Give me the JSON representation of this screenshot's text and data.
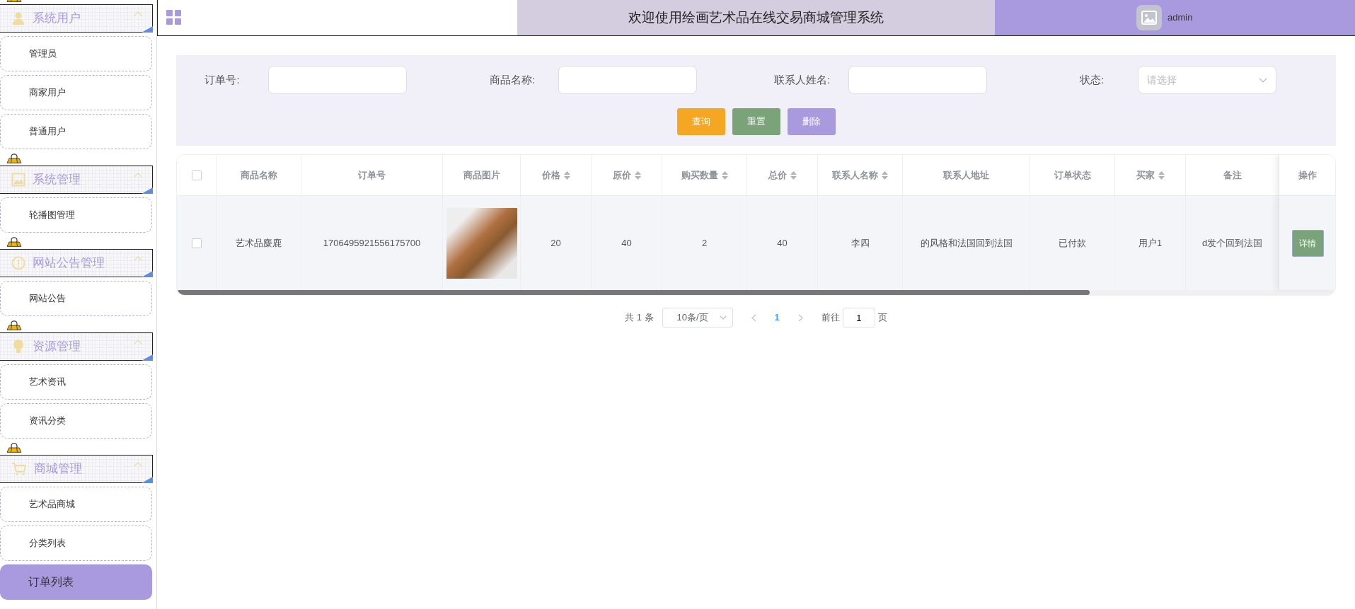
{
  "sidebar": {
    "groups": [
      {
        "title": "系统用户",
        "expanded": true,
        "items": [
          {
            "label": "管理员",
            "selected": false
          },
          {
            "label": "商家用户",
            "selected": false
          },
          {
            "label": "普通用户",
            "selected": false
          }
        ]
      },
      {
        "title": "系统管理",
        "expanded": true,
        "items": [
          {
            "label": "轮播图管理",
            "selected": false
          }
        ]
      },
      {
        "title": "网站公告管理",
        "expanded": true,
        "items": [
          {
            "label": "网站公告",
            "selected": false
          }
        ]
      },
      {
        "title": "资源管理",
        "expanded": true,
        "items": [
          {
            "label": "艺术资讯",
            "selected": false
          },
          {
            "label": "资讯分类",
            "selected": false
          }
        ]
      },
      {
        "title": "商城管理",
        "expanded": true,
        "items": [
          {
            "label": "艺术品商城",
            "selected": false
          },
          {
            "label": "分类列表",
            "selected": false
          },
          {
            "label": "订单列表",
            "selected": true
          }
        ]
      }
    ]
  },
  "header": {
    "title": "欢迎使用绘画艺术品在线交易商城管理系统",
    "user": "admin"
  },
  "search": {
    "fields": [
      {
        "label": "订单号:",
        "kind": "text"
      },
      {
        "label": "商品名称:",
        "kind": "text"
      },
      {
        "label": "联系人姓名:",
        "kind": "text"
      },
      {
        "label": "状态:",
        "kind": "select",
        "placeholder": "请选择"
      }
    ],
    "buttons": [
      {
        "label": "查询",
        "color": "#f5a623"
      },
      {
        "label": "重置",
        "color": "#7aa37a"
      },
      {
        "label": "删除",
        "color": "#a99adf"
      }
    ]
  },
  "table": {
    "all_checked": false,
    "columns": [
      {
        "title": "商品名称",
        "sortable": false
      },
      {
        "title": "订单号",
        "sortable": false
      },
      {
        "title": "商品图片",
        "sortable": false
      },
      {
        "title": "价格",
        "sortable": true
      },
      {
        "title": "原价",
        "sortable": true
      },
      {
        "title": "购买数量",
        "sortable": true
      },
      {
        "title": "总价",
        "sortable": true
      },
      {
        "title": "联系人名称",
        "sortable": true
      },
      {
        "title": "联系人地址",
        "sortable": false
      },
      {
        "title": "订单状态",
        "sortable": false
      },
      {
        "title": "买家",
        "sortable": true
      },
      {
        "title": "备注",
        "sortable": false
      },
      {
        "title": "操作",
        "sortable": false
      }
    ],
    "rows": [
      {
        "checked": false,
        "cells": [
          "艺术品麋鹿",
          "1706495921556175700",
          null,
          "20",
          "40",
          "2",
          "40",
          "李四",
          "的风格和法国回到法国",
          "已付款",
          "用户1",
          "d发个回到法国"
        ],
        "action": "详情"
      }
    ]
  },
  "pagination": {
    "total": "共 1 条",
    "page_size": "10条/页",
    "pages": [
      {
        "label": "1",
        "selected": true
      }
    ],
    "goto_label": "前往",
    "goto_value": "1",
    "goto_suffix": "页"
  }
}
